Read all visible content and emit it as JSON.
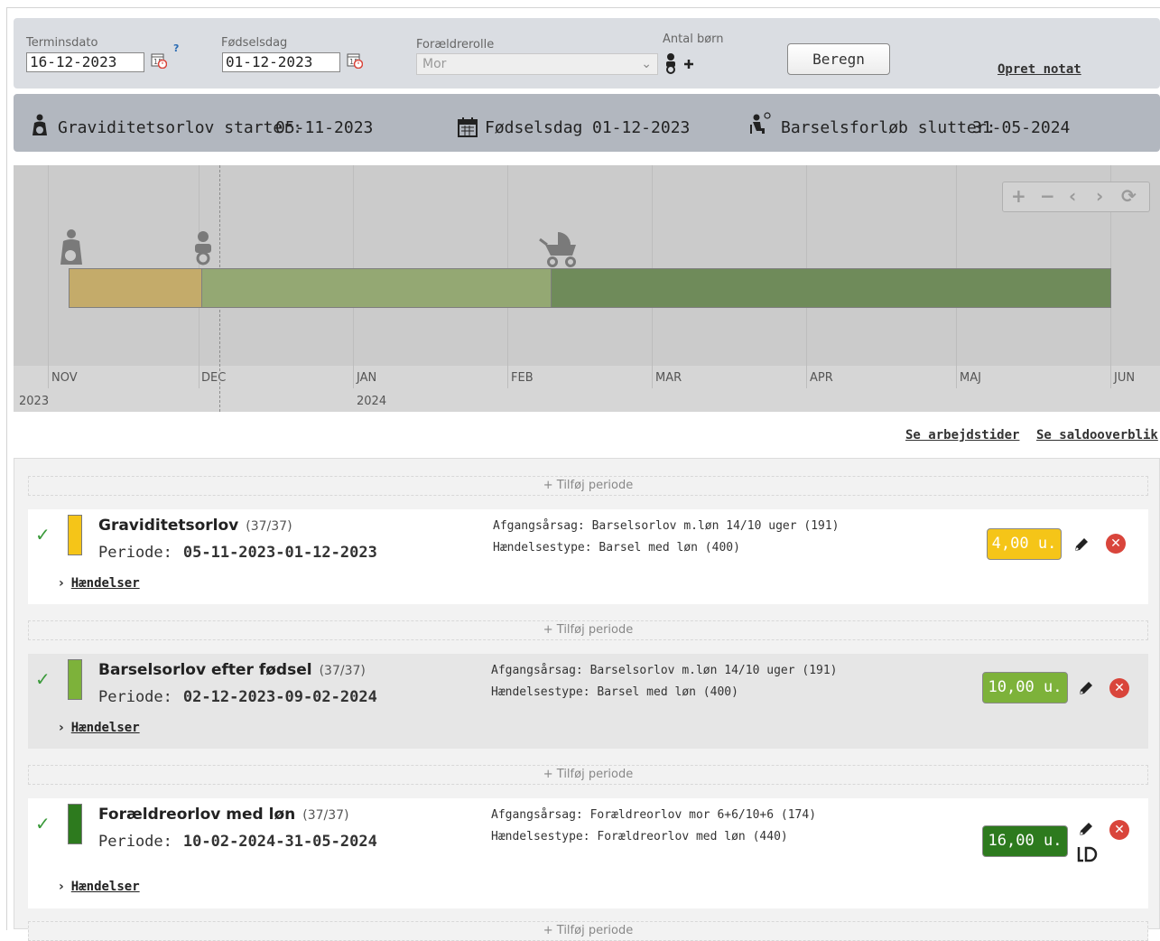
{
  "form": {
    "termin_label": "Terminsdato",
    "termin_value": "16-12-2023",
    "help_mark": "?",
    "birth_label": "Fødselsdag",
    "birth_value": "01-12-2023",
    "role_label": "Forældrerolle",
    "role_value": "Mor",
    "children_label": "Antal børn",
    "calc_button": "Beregn",
    "note_link": "Opret notat"
  },
  "summary": {
    "pregnancy_label": "Graviditetsorlov starter:",
    "pregnancy_date": "05-11-2023",
    "birth_label": "Fødselsdag",
    "birth_date": "01-12-2023",
    "end_label": "Barselsforløb slutter:",
    "end_date": "31-05-2024"
  },
  "timeline": {
    "months": [
      "NOV",
      "DEC",
      "JAN",
      "FEB",
      "MAR",
      "APR",
      "MAJ",
      "JUN"
    ],
    "years": [
      "2023",
      "2024"
    ],
    "controls": [
      "+",
      "−",
      "‹",
      "›",
      "⟳"
    ],
    "segments": [
      {
        "name": "Graviditetsorlov",
        "color": "#c4ab6a"
      },
      {
        "name": "Barselsorlov efter fødsel",
        "color": "#94a873"
      },
      {
        "name": "Forældreorlov med løn",
        "color": "#6f8b5a"
      }
    ]
  },
  "links": {
    "worktimes": "Se arbejdstider",
    "balance": "Se saldooverblik"
  },
  "add_period": "+ Tilføj periode",
  "period_prefix": "Periode:",
  "events_link": "Hændelser",
  "periods": [
    {
      "title": "Graviditetsorlov",
      "count": "(37/37)",
      "range": "05-11-2023-01-12-2023",
      "reason": "Afgangsårsag: Barselsorlov m.løn 14/10 uger (191)",
      "event_type": "Hændelsestype: Barsel med løn (400)",
      "units": "4,00 u.",
      "color": "#f5c518"
    },
    {
      "title": "Barselsorlov efter fødsel",
      "count": "(37/37)",
      "range": "02-12-2023-09-02-2024",
      "reason": "Afgangsårsag: Barselsorlov m.løn 14/10 uger (191)",
      "event_type": "Hændelsestype: Barsel med løn (400)",
      "units": "10,00 u.",
      "color": "#7db23a"
    },
    {
      "title": "Forældreorlov med løn",
      "count": "(37/37)",
      "range": "10-02-2024-31-05-2024",
      "reason": "Afgangsårsag: Forældreorlov mor 6+6/10+6 (174)",
      "event_type": "Hændelsestype: Forældreorlov med løn (440)",
      "units": "16,00 u.",
      "color": "#2d7a1e"
    }
  ]
}
